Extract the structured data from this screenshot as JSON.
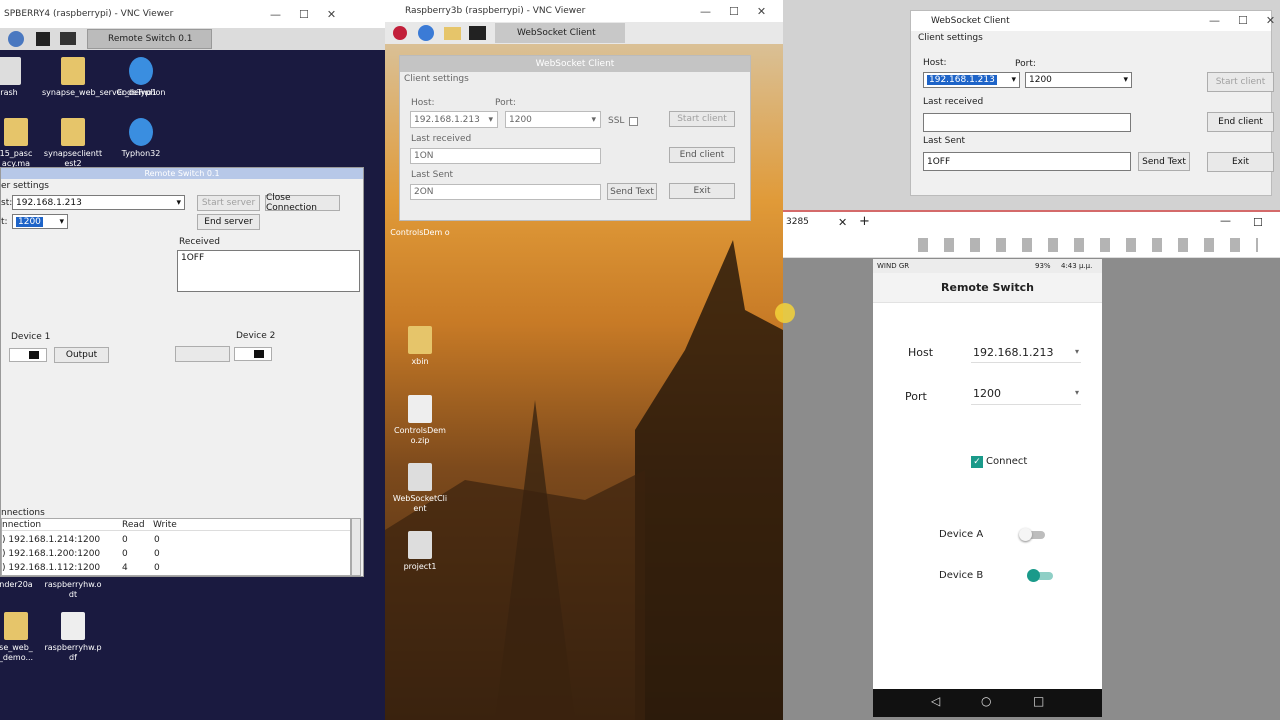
{
  "vnc1": {
    "title": "SPBERRY4 (raspberrypi) - VNC Viewer",
    "taskbar_label": "Remote Switch 0.1",
    "desktop_icons": [
      "rash",
      "synapse_web_server_demo1",
      "CodeTyphon",
      "15_pasc acy.ma",
      "synapseclientt est2",
      "Typhon32",
      "nder20a",
      "raspberryhw.o dt",
      "se_web_ _demo...",
      "raspberryhw.p df"
    ],
    "rs": {
      "title": "Remote Switch 0.1",
      "group": "er settings",
      "host_label": "st:",
      "host": "192.168.1.213",
      "port_label": "t:",
      "port": "1200",
      "start": "Start server",
      "close": "Close Connection",
      "end": "End server",
      "received_label": "Received",
      "received": "1OFF",
      "device1": "Device 1",
      "device2": "Device 2",
      "output": "Output",
      "connections": "nnections",
      "headers": [
        "nnection",
        "Read",
        "Write"
      ],
      "rows": [
        [
          ") 192.168.1.214:1200",
          "0",
          "0"
        ],
        [
          ") 192.168.1.200:1200",
          "0",
          "0"
        ],
        [
          ") 192.168.1.112:1200",
          "4",
          "0"
        ]
      ]
    }
  },
  "vnc2": {
    "title": "Raspberry3b (raspberrypi) - VNC Viewer",
    "taskbar_app": "WebSocket Client",
    "wsc": {
      "title": "WebSocket Client",
      "group": "Client settings",
      "host_label": "Host:",
      "port_label": "Port:",
      "host": "192.168.1.213",
      "port": "1200",
      "ssl": "SSL",
      "start": "Start client",
      "last_received_label": "Last received",
      "last_received": "1ON",
      "end": "End client",
      "last_sent_label": "Last Sent",
      "last_sent": "2ON",
      "send": "Send Text",
      "exit": "Exit"
    },
    "desktop_icons": [
      "ControlsDem o",
      "xbin",
      "ControlsDem o.zip",
      "WebSocketCli ent",
      "project1"
    ]
  },
  "win_ws": {
    "title": "WebSocket Client",
    "group": "Client settings",
    "host_label": "Host:",
    "port_label": "Port:",
    "host": "192.168.1.213",
    "port": "1200",
    "start": "Start client",
    "last_received_label": "Last received",
    "end": "End client",
    "last_sent_label": "Last Sent",
    "last_sent": "1OFF",
    "send": "Send Text",
    "exit": "Exit"
  },
  "browser": {
    "tab": "3285",
    "status": "WIND GR",
    "battery": "93%",
    "time": "4:43 μ.μ."
  },
  "android": {
    "title": "Remote Switch",
    "host_label": "Host",
    "host": "192.168.1.213",
    "port_label": "Port",
    "port": "1200",
    "connect": "Connect",
    "device_a": "Device A",
    "device_b": "Device B"
  },
  "colors": {
    "android_teal": "#1a9a8a",
    "desktop_dark": "#1a1a40"
  }
}
